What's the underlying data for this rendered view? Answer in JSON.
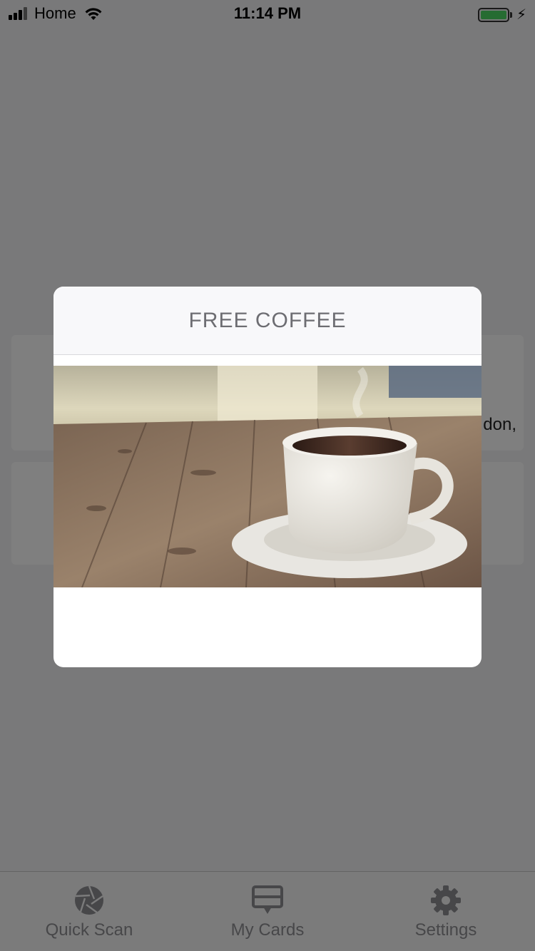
{
  "status_bar": {
    "carrier": "Home",
    "time": "11:14 PM"
  },
  "background": {
    "card_text": "don,"
  },
  "modal": {
    "title": "FREE COFFEE",
    "image": "coffee-cup-photo"
  },
  "tab_bar": {
    "tabs": [
      {
        "label": "Quick Scan",
        "icon": "aperture-icon"
      },
      {
        "label": "My Cards",
        "icon": "card-icon"
      },
      {
        "label": "Settings",
        "icon": "gear-icon"
      }
    ]
  },
  "colors": {
    "overlay": "#000000",
    "battery": "#4cd964",
    "modal_header_bg": "#f8f8fa",
    "tab_inactive": "#8e8e93"
  }
}
